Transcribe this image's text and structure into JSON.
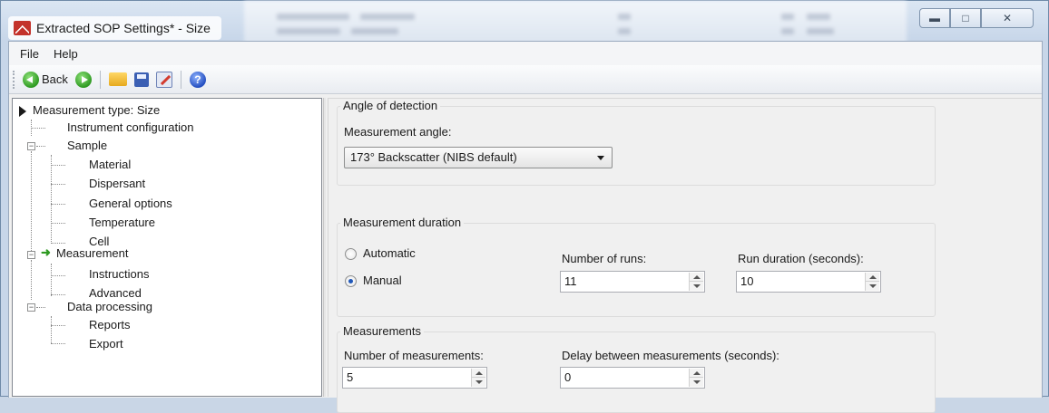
{
  "window": {
    "title": "Extracted SOP Settings* - Size"
  },
  "menu": {
    "file": "File",
    "help": "Help"
  },
  "toolbar": {
    "back_label": "Back"
  },
  "tree": {
    "items": [
      {
        "label": "Measurement type: Size"
      },
      {
        "label": "Instrument configuration"
      },
      {
        "label": "Sample"
      },
      {
        "label": "Material"
      },
      {
        "label": "Dispersant"
      },
      {
        "label": "General options"
      },
      {
        "label": "Temperature"
      },
      {
        "label": "Cell"
      },
      {
        "label": "Measurement"
      },
      {
        "label": "Instructions"
      },
      {
        "label": "Advanced"
      },
      {
        "label": "Data processing"
      },
      {
        "label": "Reports"
      },
      {
        "label": "Export"
      }
    ]
  },
  "angle": {
    "group_title": "Angle of detection",
    "label": "Measurement angle:",
    "selected": "173° Backscatter (NIBS default)"
  },
  "duration": {
    "group_title": "Measurement duration",
    "automatic_label": "Automatic",
    "manual_label": "Manual",
    "selected_mode": "Manual",
    "runs_label": "Number of runs:",
    "runs_value": "11",
    "run_duration_label": "Run duration (seconds):",
    "run_duration_value": "10"
  },
  "measurements": {
    "group_title": "Measurements",
    "count_label": "Number of measurements:",
    "count_value": "5",
    "delay_label": "Delay between measurements (seconds):",
    "delay_value": "0"
  }
}
